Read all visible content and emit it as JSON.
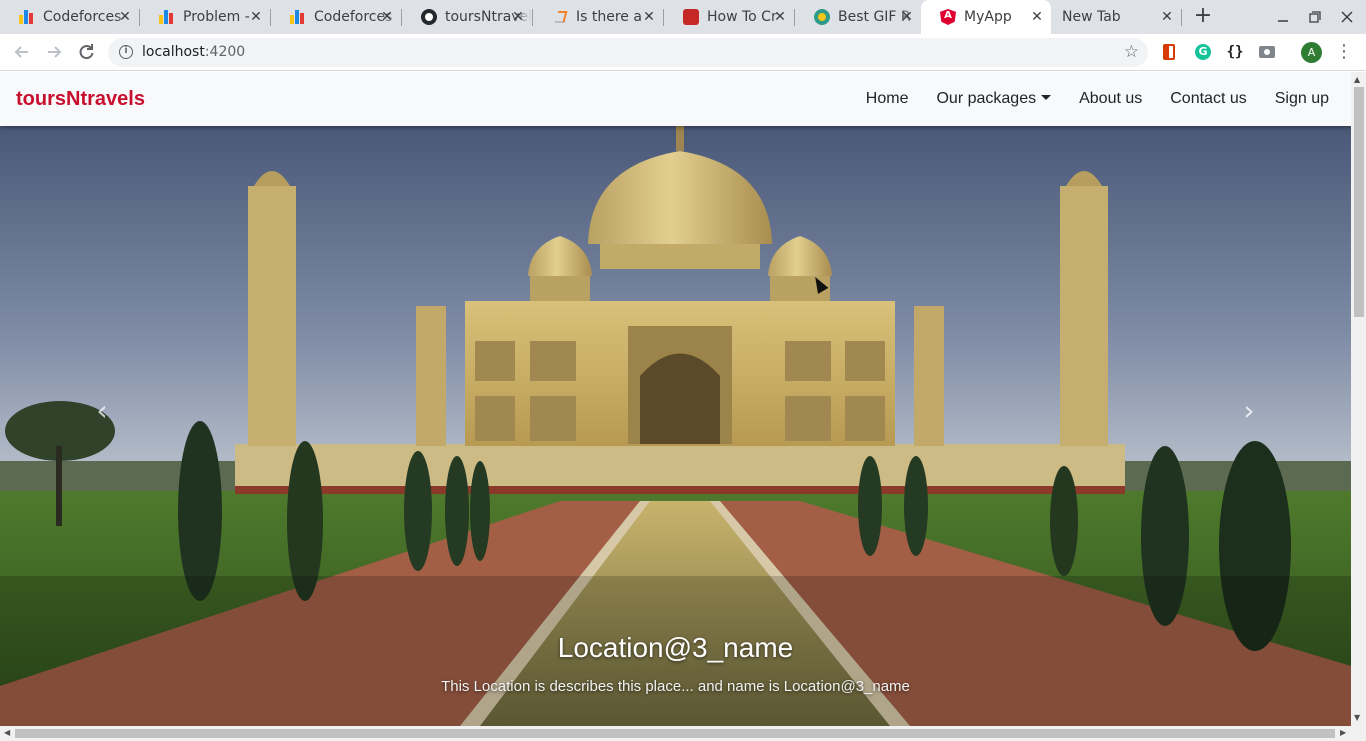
{
  "browser": {
    "tabs": [
      {
        "title": "Codeforces",
        "favicon": "codeforces-icon"
      },
      {
        "title": "Problem - ",
        "favicon": "codeforces-icon"
      },
      {
        "title": "Codeforces",
        "favicon": "codeforces-icon"
      },
      {
        "title": "toursNtravels",
        "favicon": "github-icon"
      },
      {
        "title": "Is there a",
        "favicon": "stackoverflow-icon"
      },
      {
        "title": "How To Cr",
        "favicon": "howtocreate-icon"
      },
      {
        "title": "Best GIF R",
        "favicon": "gif-icon"
      },
      {
        "title": "MyApp",
        "favicon": "angular-icon",
        "active": true
      },
      {
        "title": "New Tab",
        "favicon": ""
      }
    ],
    "new_tab_label": "+",
    "address": {
      "host": "localhost",
      "port": ":4200"
    },
    "profile_initial": "A"
  },
  "app": {
    "brand": "toursNtravels",
    "brand_color": "#c8102e",
    "nav": {
      "home": "Home",
      "packages": "Our packages",
      "about": "About us",
      "contact": "Contact us",
      "signup": "Sign up"
    },
    "carousel": {
      "slide_title": "Location@3_name",
      "slide_text": "This Location is describes this place... and name is Location@3_name",
      "prev_icon": "chevron-left-icon",
      "next_icon": "chevron-right-icon",
      "prev_glyph": "‹",
      "next_glyph": "›"
    }
  }
}
